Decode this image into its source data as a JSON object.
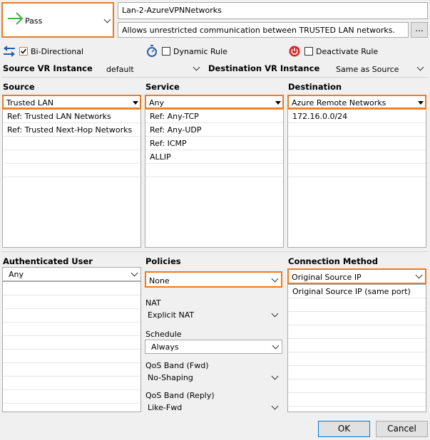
{
  "action": {
    "label": "Pass"
  },
  "rule": {
    "name": "Lan-2-AzureVPNNetworks",
    "description": "Allows unrestricted communication between TRUSTED LAN networks.",
    "ellipsis": "..."
  },
  "options": {
    "bidirectional": {
      "label": "Bi-Directional",
      "checked": true
    },
    "dynamic": {
      "label": "Dynamic Rule",
      "checked": false
    },
    "deactivate": {
      "label": "Deactivate Rule",
      "checked": false
    }
  },
  "vr": {
    "source_label": "Source VR Instance",
    "source_value": "default",
    "dest_label": "Destination VR Instance",
    "dest_value": "Same as Source"
  },
  "source": {
    "label": "Source",
    "selected": "Trusted  LAN",
    "items": [
      "Ref: Trusted LAN Networks",
      "Ref: Trusted Next-Hop Networks"
    ]
  },
  "service": {
    "label": "Service",
    "selected": "Any",
    "items": [
      "Ref: Any-TCP",
      "Ref: Any-UDP",
      "Ref: ICMP",
      "ALLIP"
    ]
  },
  "destination": {
    "label": "Destination",
    "selected": "Azure Remote Networks",
    "items": [
      "172.16.0.0/24"
    ]
  },
  "auth": {
    "label": "Authenticated User",
    "selected": "Any"
  },
  "policies": {
    "label": "Policies",
    "selected": "None",
    "nat_label": "NAT",
    "nat_value": "Explicit NAT",
    "schedule_label": "Schedule",
    "schedule_value": "Always",
    "qos_fwd_label": "QoS Band (Fwd)",
    "qos_fwd_value": "No-Shaping",
    "qos_reply_label": "QoS Band (Reply)",
    "qos_reply_value": "Like-Fwd"
  },
  "connection": {
    "label": "Connection Method",
    "selected": "Original Source IP",
    "items": [
      "Original Source IP (same port)"
    ]
  },
  "buttons": {
    "ok": "OK",
    "cancel": "Cancel"
  },
  "colors": {
    "highlight": "#ee7a1e",
    "pass_arrow": "#3cb43c",
    "deactivate": "#e02020"
  }
}
